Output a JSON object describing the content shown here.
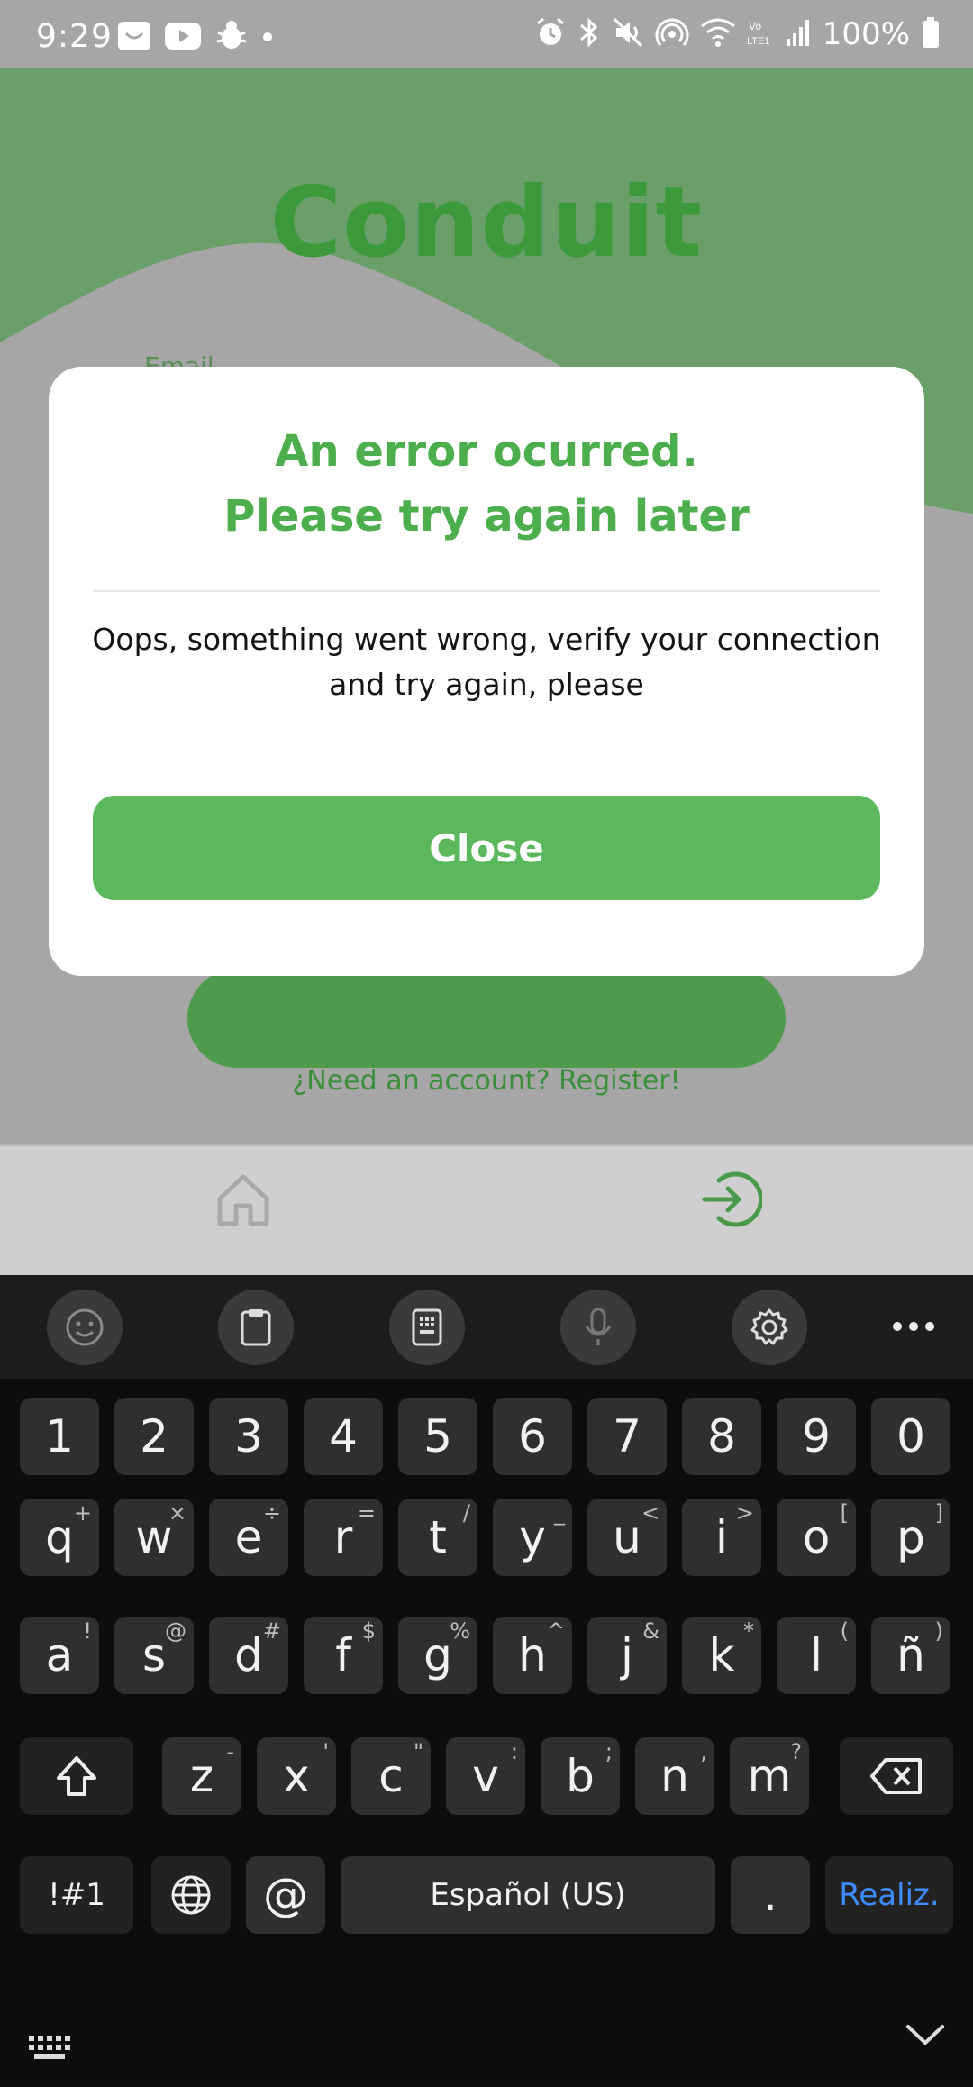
{
  "status_bar": {
    "time": "9:29",
    "battery": "100%",
    "left_icons": [
      "app-notification-icon",
      "youtube-icon",
      "bug-icon",
      "dot-icon"
    ],
    "right_icons": [
      "alarm-icon",
      "bluetooth-icon",
      "mute-icon",
      "hotspot-icon",
      "wifi-icon",
      "volte-icon",
      "signal-icon",
      "battery-icon"
    ]
  },
  "app": {
    "title": "Conduit",
    "email_label": "Email",
    "register_link": "¿Need an account? Register!",
    "colors": {
      "brand_green": "#5cb85c",
      "overlay_gray": "#a6a6a6"
    }
  },
  "bottom_nav": {
    "items": [
      {
        "name": "home",
        "icon": "home-icon"
      },
      {
        "name": "login",
        "icon": "login-icon",
        "active": true
      }
    ]
  },
  "modal": {
    "title_line1": "An error ocurred.",
    "title_line2": "Please try again later",
    "message": "Oops, something went wrong, verify your connection and try again, please",
    "close_label": "Close"
  },
  "keyboard": {
    "toolbar": [
      "emoji-icon",
      "clipboard-icon",
      "keypad-icon",
      "mic-icon",
      "settings-icon",
      "more-icon"
    ],
    "row_numbers": [
      "1",
      "2",
      "3",
      "4",
      "5",
      "6",
      "7",
      "8",
      "9",
      "0"
    ],
    "row1": [
      {
        "k": "q",
        "s": "+"
      },
      {
        "k": "w",
        "s": "×"
      },
      {
        "k": "e",
        "s": "÷"
      },
      {
        "k": "r",
        "s": "="
      },
      {
        "k": "t",
        "s": "/"
      },
      {
        "k": "y",
        "s": "_"
      },
      {
        "k": "u",
        "s": "<"
      },
      {
        "k": "i",
        "s": ">"
      },
      {
        "k": "o",
        "s": "["
      },
      {
        "k": "p",
        "s": "]"
      }
    ],
    "row2": [
      {
        "k": "a",
        "s": "!"
      },
      {
        "k": "s",
        "s": "@"
      },
      {
        "k": "d",
        "s": "#"
      },
      {
        "k": "f",
        "s": "$"
      },
      {
        "k": "g",
        "s": "%"
      },
      {
        "k": "h",
        "s": "^"
      },
      {
        "k": "j",
        "s": "&"
      },
      {
        "k": "k",
        "s": "*"
      },
      {
        "k": "l",
        "s": "("
      },
      {
        "k": "ñ",
        "s": ")"
      }
    ],
    "row3": [
      {
        "k": "z",
        "s": "-"
      },
      {
        "k": "x",
        "s": "'"
      },
      {
        "k": "c",
        "s": "\""
      },
      {
        "k": "v",
        "s": ":"
      },
      {
        "k": "b",
        "s": ";"
      },
      {
        "k": "n",
        "s": ","
      },
      {
        "k": "m",
        "s": "?"
      }
    ],
    "symbols_key": "!#1",
    "at_key": "@",
    "space_label": "Español (US)",
    "period_key": ".",
    "action_key": "Realiz."
  }
}
